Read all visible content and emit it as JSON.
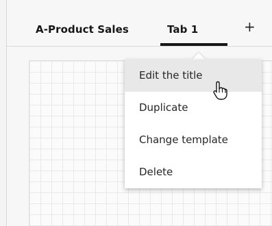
{
  "tabs": [
    {
      "label": "A-Product Sales"
    },
    {
      "label": "Tab 1",
      "active": true
    }
  ],
  "add_tab_label": "+",
  "context_menu": {
    "items": [
      {
        "label": "Edit the title",
        "hovered": true
      },
      {
        "label": "Duplicate"
      },
      {
        "label": "Change template"
      },
      {
        "label": "Delete"
      }
    ]
  },
  "icons": {
    "cursor": "hand-pointer-icon"
  }
}
